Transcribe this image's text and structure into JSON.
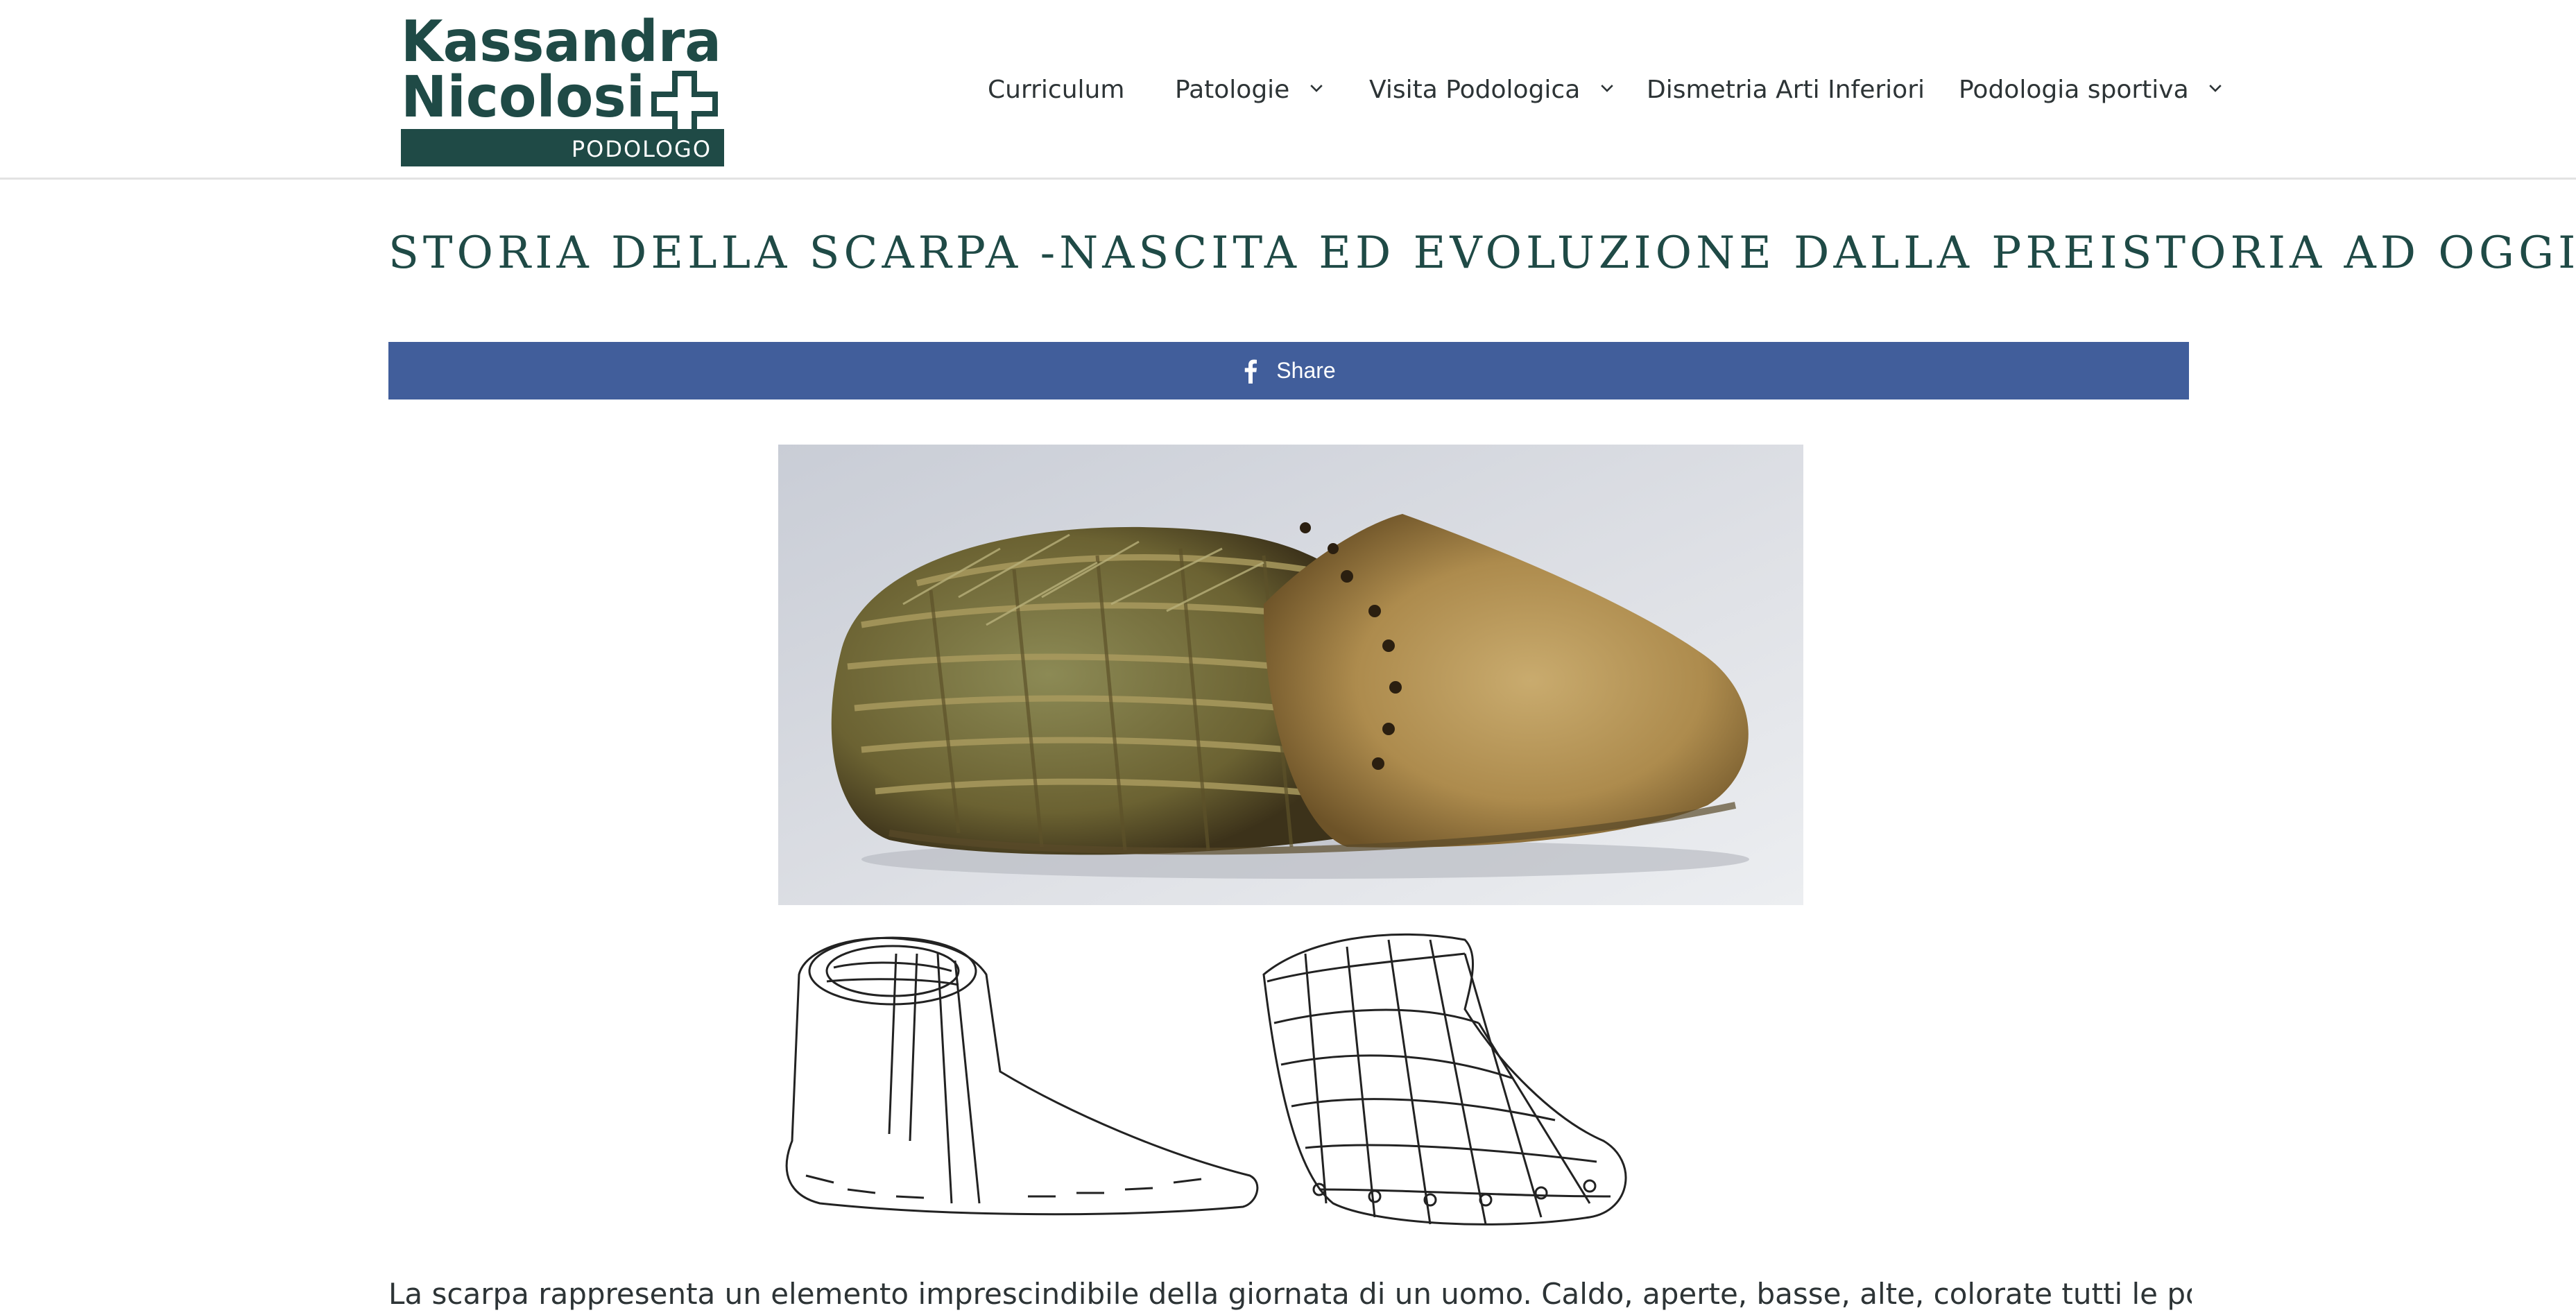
{
  "header": {
    "logo": {
      "line1": "Kassandra",
      "line2": "Nicolosi",
      "tagline": "PODOLOGO",
      "brand_color": "#1f4a46"
    },
    "nav": [
      {
        "label": "Curriculum",
        "has_dropdown": false
      },
      {
        "label": "Patologie",
        "has_dropdown": true
      },
      {
        "label": "Visita Podologica",
        "has_dropdown": true
      },
      {
        "label": "Dismetria Arti Inferiori",
        "has_dropdown": false
      },
      {
        "label": "Podologia sportiva",
        "has_dropdown": true
      }
    ]
  },
  "article": {
    "title": "STORIA DELLA SCARPA -NASCITA ED EVOLUZIONE DALLA PREISTORIA AD OGGI",
    "share": {
      "label": "Share",
      "icon": "facebook-icon",
      "color": "#415e9b"
    },
    "images": [
      {
        "name": "prehistoric-grass-shoe-photo"
      },
      {
        "name": "prehistoric-shoe-drawings"
      }
    ],
    "intro_text": "La scarpa rappresenta un elemento imprescindibile della giornata di un uomo. Caldo, aperte, basse, alte, colorate tutti le possediamo oggi giorno"
  },
  "colors": {
    "title": "#1f4a46",
    "text": "#2d3436",
    "share_bar": "#415e9b"
  }
}
